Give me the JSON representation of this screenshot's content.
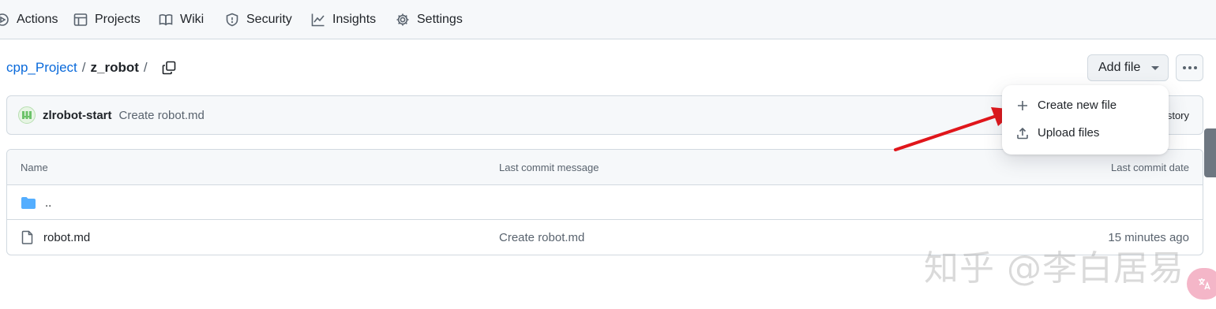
{
  "nav": {
    "items": [
      {
        "label": "Actions",
        "icon": "actions-icon"
      },
      {
        "label": "Projects",
        "icon": "table-icon"
      },
      {
        "label": "Wiki",
        "icon": "book-icon"
      },
      {
        "label": "Security",
        "icon": "shield-icon"
      },
      {
        "label": "Insights",
        "icon": "graph-icon"
      },
      {
        "label": "Settings",
        "icon": "gear-icon"
      }
    ]
  },
  "breadcrumb": {
    "repo": "cpp_Project",
    "separator": "/",
    "folder": "z_robot",
    "trailing_separator": "/"
  },
  "buttons": {
    "add_file": "Add file"
  },
  "commit": {
    "author": "zlrobot-start",
    "message": "Create robot.md",
    "history_label": "story"
  },
  "table": {
    "headers": {
      "name": "Name",
      "message": "Last commit message",
      "date": "Last commit date"
    },
    "rows": [
      {
        "name": "..",
        "type": "folder",
        "message": "",
        "date": ""
      },
      {
        "name": "robot.md",
        "type": "file",
        "message": "Create robot.md",
        "date": "15 minutes ago"
      }
    ]
  },
  "menu": {
    "items": [
      {
        "label": "Create new file",
        "icon": "plus-icon"
      },
      {
        "label": "Upload files",
        "icon": "upload-icon"
      }
    ]
  },
  "watermark": "知乎 @李白居易",
  "colors": {
    "link": "#0969da",
    "annotation_arrow": "#e0161b",
    "header_bg": "#f6f8fa",
    "border": "#d1d9e0"
  }
}
